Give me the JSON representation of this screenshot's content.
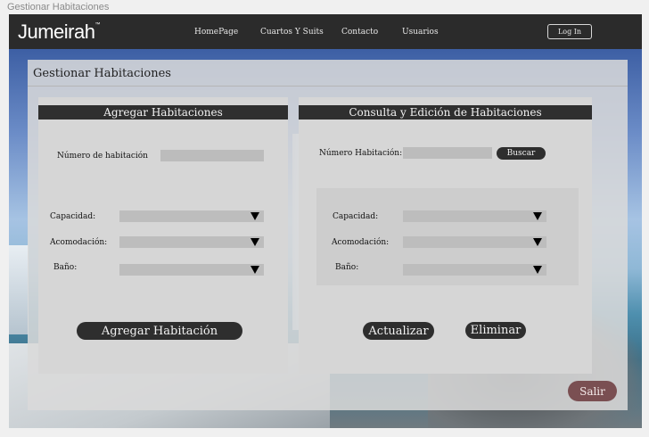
{
  "window": {
    "title": "Gestionar Habitaciones"
  },
  "navbar": {
    "brand": "Jumeirah",
    "brand_mark": "™",
    "links": [
      "HomePage",
      "Cuartos Y Suits",
      "Contacto",
      "Usuarios"
    ],
    "login_label": "Log In"
  },
  "page": {
    "title": "Gestionar Habitaciones"
  },
  "add_section": {
    "heading": "Agregar Habitaciones",
    "room_number_label": "Número de habitación",
    "room_number_value": "",
    "capacity_label": "Capacidad:",
    "capacity_value": "",
    "accommodation_label": "Acomodación:",
    "accommodation_value": "",
    "bathroom_label": "Baño:",
    "bathroom_value": "",
    "submit_label": "Agregar Habitación"
  },
  "query_section": {
    "heading": "Consulta y Edición de Habitaciones",
    "room_number_label": "Número Habitación:",
    "room_number_value": "",
    "search_label": "Buscar",
    "capacity_label": "Capacidad:",
    "capacity_value": "",
    "accommodation_label": "Acomodación:",
    "accommodation_value": "",
    "bathroom_label": "Baño:",
    "bathroom_value": "",
    "update_label": "Actualizar",
    "delete_label": "Eliminar"
  },
  "exit_label": "Salir",
  "colors": {
    "navbar_bg": "#2b2b2b",
    "section_header_bg": "#2f2f2f",
    "button_dark": "#2e2e2e",
    "exit_button": "#7a4f52",
    "panel_bg": "#dadada"
  },
  "icons": {
    "select_arrow": "triangle-down-icon"
  }
}
